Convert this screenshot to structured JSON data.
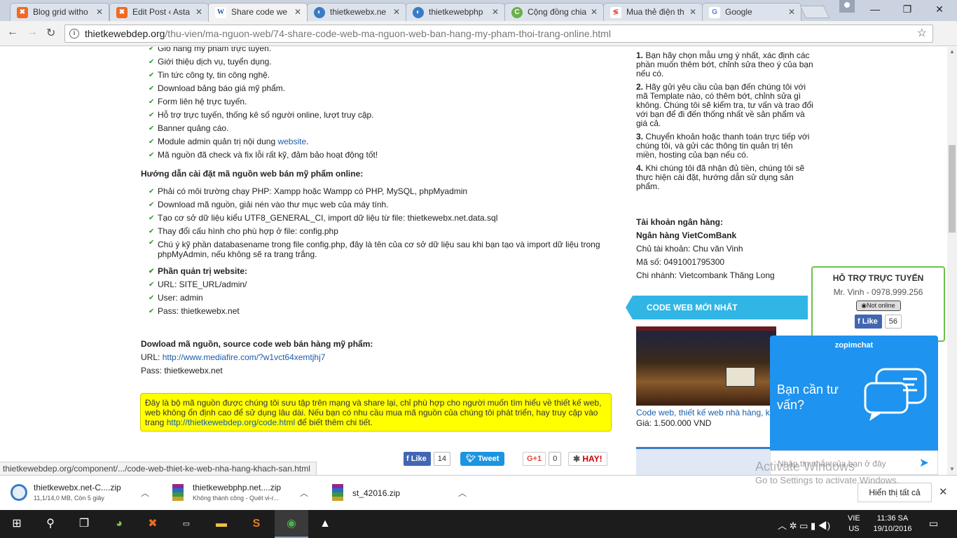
{
  "tabs": [
    {
      "title": "Blog grid witho",
      "icon": "xampp-icon",
      "color": "#f26922"
    },
    {
      "title": "Edit Post ‹ Asta",
      "icon": "xampp-icon",
      "color": "#f26922"
    },
    {
      "title": "Share code we",
      "icon": "w-icon",
      "color": "#1a5ea8"
    },
    {
      "title": "thietkewebx.ne",
      "icon": "site-icon",
      "color": "#3a7bc8"
    },
    {
      "title": "thietkewebphp",
      "icon": "site-icon",
      "color": "#3a7bc8"
    },
    {
      "title": "Cộng đồng chia",
      "icon": "community-icon",
      "color": "#6ab04c"
    },
    {
      "title": "Mua thẻ điện th",
      "icon": "shop-icon",
      "color": "#e74c3c"
    },
    {
      "title": "Google",
      "icon": "google-icon",
      "color": "#4285f4"
    }
  ],
  "address": {
    "host": "thietkewebdep.org",
    "path": "/thu-vien/ma-nguon-web/74-share-code-web-ma-nguon-web-ban-hang-my-pham-thoi-trang-online.html"
  },
  "features": [
    "Giỏ hàng mỹ phẩm trực tuyến.",
    "Giới thiệu dịch vụ, tuyển dụng.",
    "Tin tức công ty, tin công nghệ.",
    "Download bảng báo giá mỹ phẩm.",
    "Form liên hệ trực tuyến.",
    "Hỗ trợ trực tuyến, thống kê số người online, lượt truy cập.",
    "Banner quảng cáo."
  ],
  "feature_module": {
    "prefix": "Module admin quản trị nội dung ",
    "link": "website",
    "suffix": "."
  },
  "feature_last": "Mã nguồn đã check và fix lỗi rất kỹ, đảm bảo hoạt động tốt!",
  "install_heading": "Hướng dẫn cài đặt mã nguồn web bán mỹ phẩm online:",
  "install_steps": [
    "Phải có môi trường chạy PHP: Xampp hoặc Wampp có PHP, MySQL, phpMyadmin",
    "Download mã nguồn, giải nén vào thư mục web của máy tính.",
    "Tạo cơ sở dữ liệu kiểu UTF8_GENERAL_CI, import dữ liệu từ file: thietkewebx.net.data.sql",
    "Thay đổi cấu hình cho phù hợp ở file: config.php"
  ],
  "install_step5_line1": "Chú ý kỹ phần databasename trong file config.php, đây là tên của cơ sở dữ liệu sau khi bạn tạo và import dữ liệu trong",
  "install_step5_line2": "phpMyAdmin, nếu không sẽ ra trang trắng.",
  "admin_heading": "Phần quản trị website:",
  "admin_items": [
    "URL: SITE_URL/admin/",
    "User: admin",
    "Pass: thietkewebx.net"
  ],
  "download_heading": "Dowload mã nguồn, source code web bán hàng mỹ phẩm:",
  "download_url_label": "URL: ",
  "download_url": "http://www.mediafire.com/?w1vct64xemtjhj7",
  "download_pass": "Pass: thietkewebx.net",
  "note": {
    "line1": "Đây là bộ mã nguồn được chúng tôi sưu tập trên mạng và share lại, chỉ phù hợp cho người muốn tìm hiểu về thiết kế web,",
    "line2": "web không ổn định cao để sử dụng lâu dài. Nếu bạn có nhu cầu mua mã nguồn của chúng tôi phát triển, hay truy cập vào",
    "line3_prefix": "trang ",
    "line3_link": "http://thietkewebdep.org/code.html",
    "line3_suffix": " để biết thêm chi tiết."
  },
  "share": {
    "like": "Like",
    "like_count": "14",
    "tweet": "Tweet",
    "gplus": "G+1",
    "gplus_count": "0",
    "hay": "HAY!"
  },
  "steps": [
    {
      "num": "1.",
      "lines": [
        "Bạn hãy chọn mẫu ưng ý nhất, xác định các",
        "phần muốn thêm bớt, chỉnh sửa theo ý của bạn",
        "nếu có."
      ]
    },
    {
      "num": "2.",
      "lines": [
        "Hãy gửi yêu cầu của bạn đến chúng tôi với",
        "mã Template nào, có thêm bớt, chỉnh sửa gì",
        "không. Chúng tôi sẽ kiểm tra, tư vấn và trao đổi",
        "với bạn để đi đến thống nhất về sản phẩm và",
        "giá cả."
      ]
    },
    {
      "num": "3.",
      "lines": [
        "Chuyển khoản hoặc thanh toán trực tiếp với",
        "chúng tôi, và gửi các thông tin quản trị tên",
        "miền, hosting của bạn nếu có."
      ]
    },
    {
      "num": "4.",
      "lines": [
        "Khi chúng tôi đã nhận đủ tiền, chúng tôi sẽ",
        "thực hiện cài đặt, hướng dẫn sử dụng sản",
        "phẩm."
      ]
    }
  ],
  "bank": {
    "title": "Tài khoản ngân hàng:",
    "name": "Ngân hàng VietComBank",
    "owner": "Chủ tài khoản: Chu văn Vinh",
    "number": "Mã số: 0491001795300",
    "branch": "Chi nhánh: Vietcombank Thăng Long"
  },
  "new_code_heading": "CODE WEB MỚI NHẤT",
  "product": {
    "title": "Code web, thiết kế web nhà hàng, k",
    "price": "Giá: 1.500.000 VND"
  },
  "support": {
    "title": "HỖ TRỢ TRỰC TUYẾN",
    "contact": "Mr. Vinh - 0978.999.256",
    "status": "Not online",
    "like": "Like",
    "like_count": "56"
  },
  "zopim": {
    "brand": "zopimchat",
    "prompt_line1": "Bạn cần tư",
    "prompt_line2": "vấn?",
    "placeholder": "Nhập tin nhắn của bạn ở đây"
  },
  "activate": {
    "title": "Activate Windows",
    "sub": "Go to Settings to activate Windows."
  },
  "status_url": "thietkewebdep.org/component/.../code-web-thiet-ke-web-nha-hang-khach-san.html",
  "downloads": [
    {
      "name": "thietkewebx.net-C....zip",
      "sub": "11,1/14,0 MB, Còn 5 giây"
    },
    {
      "name": "thietkewebphp.net....zip",
      "sub": "Không thành công - Quét vi-r..."
    },
    {
      "name": "st_42016.zip",
      "sub": ""
    }
  ],
  "show_all": "Hiển thị tất cả",
  "tray": {
    "lang1": "VIE",
    "lang2": "US",
    "time": "11:36 SA",
    "date": "19/10/2016"
  }
}
